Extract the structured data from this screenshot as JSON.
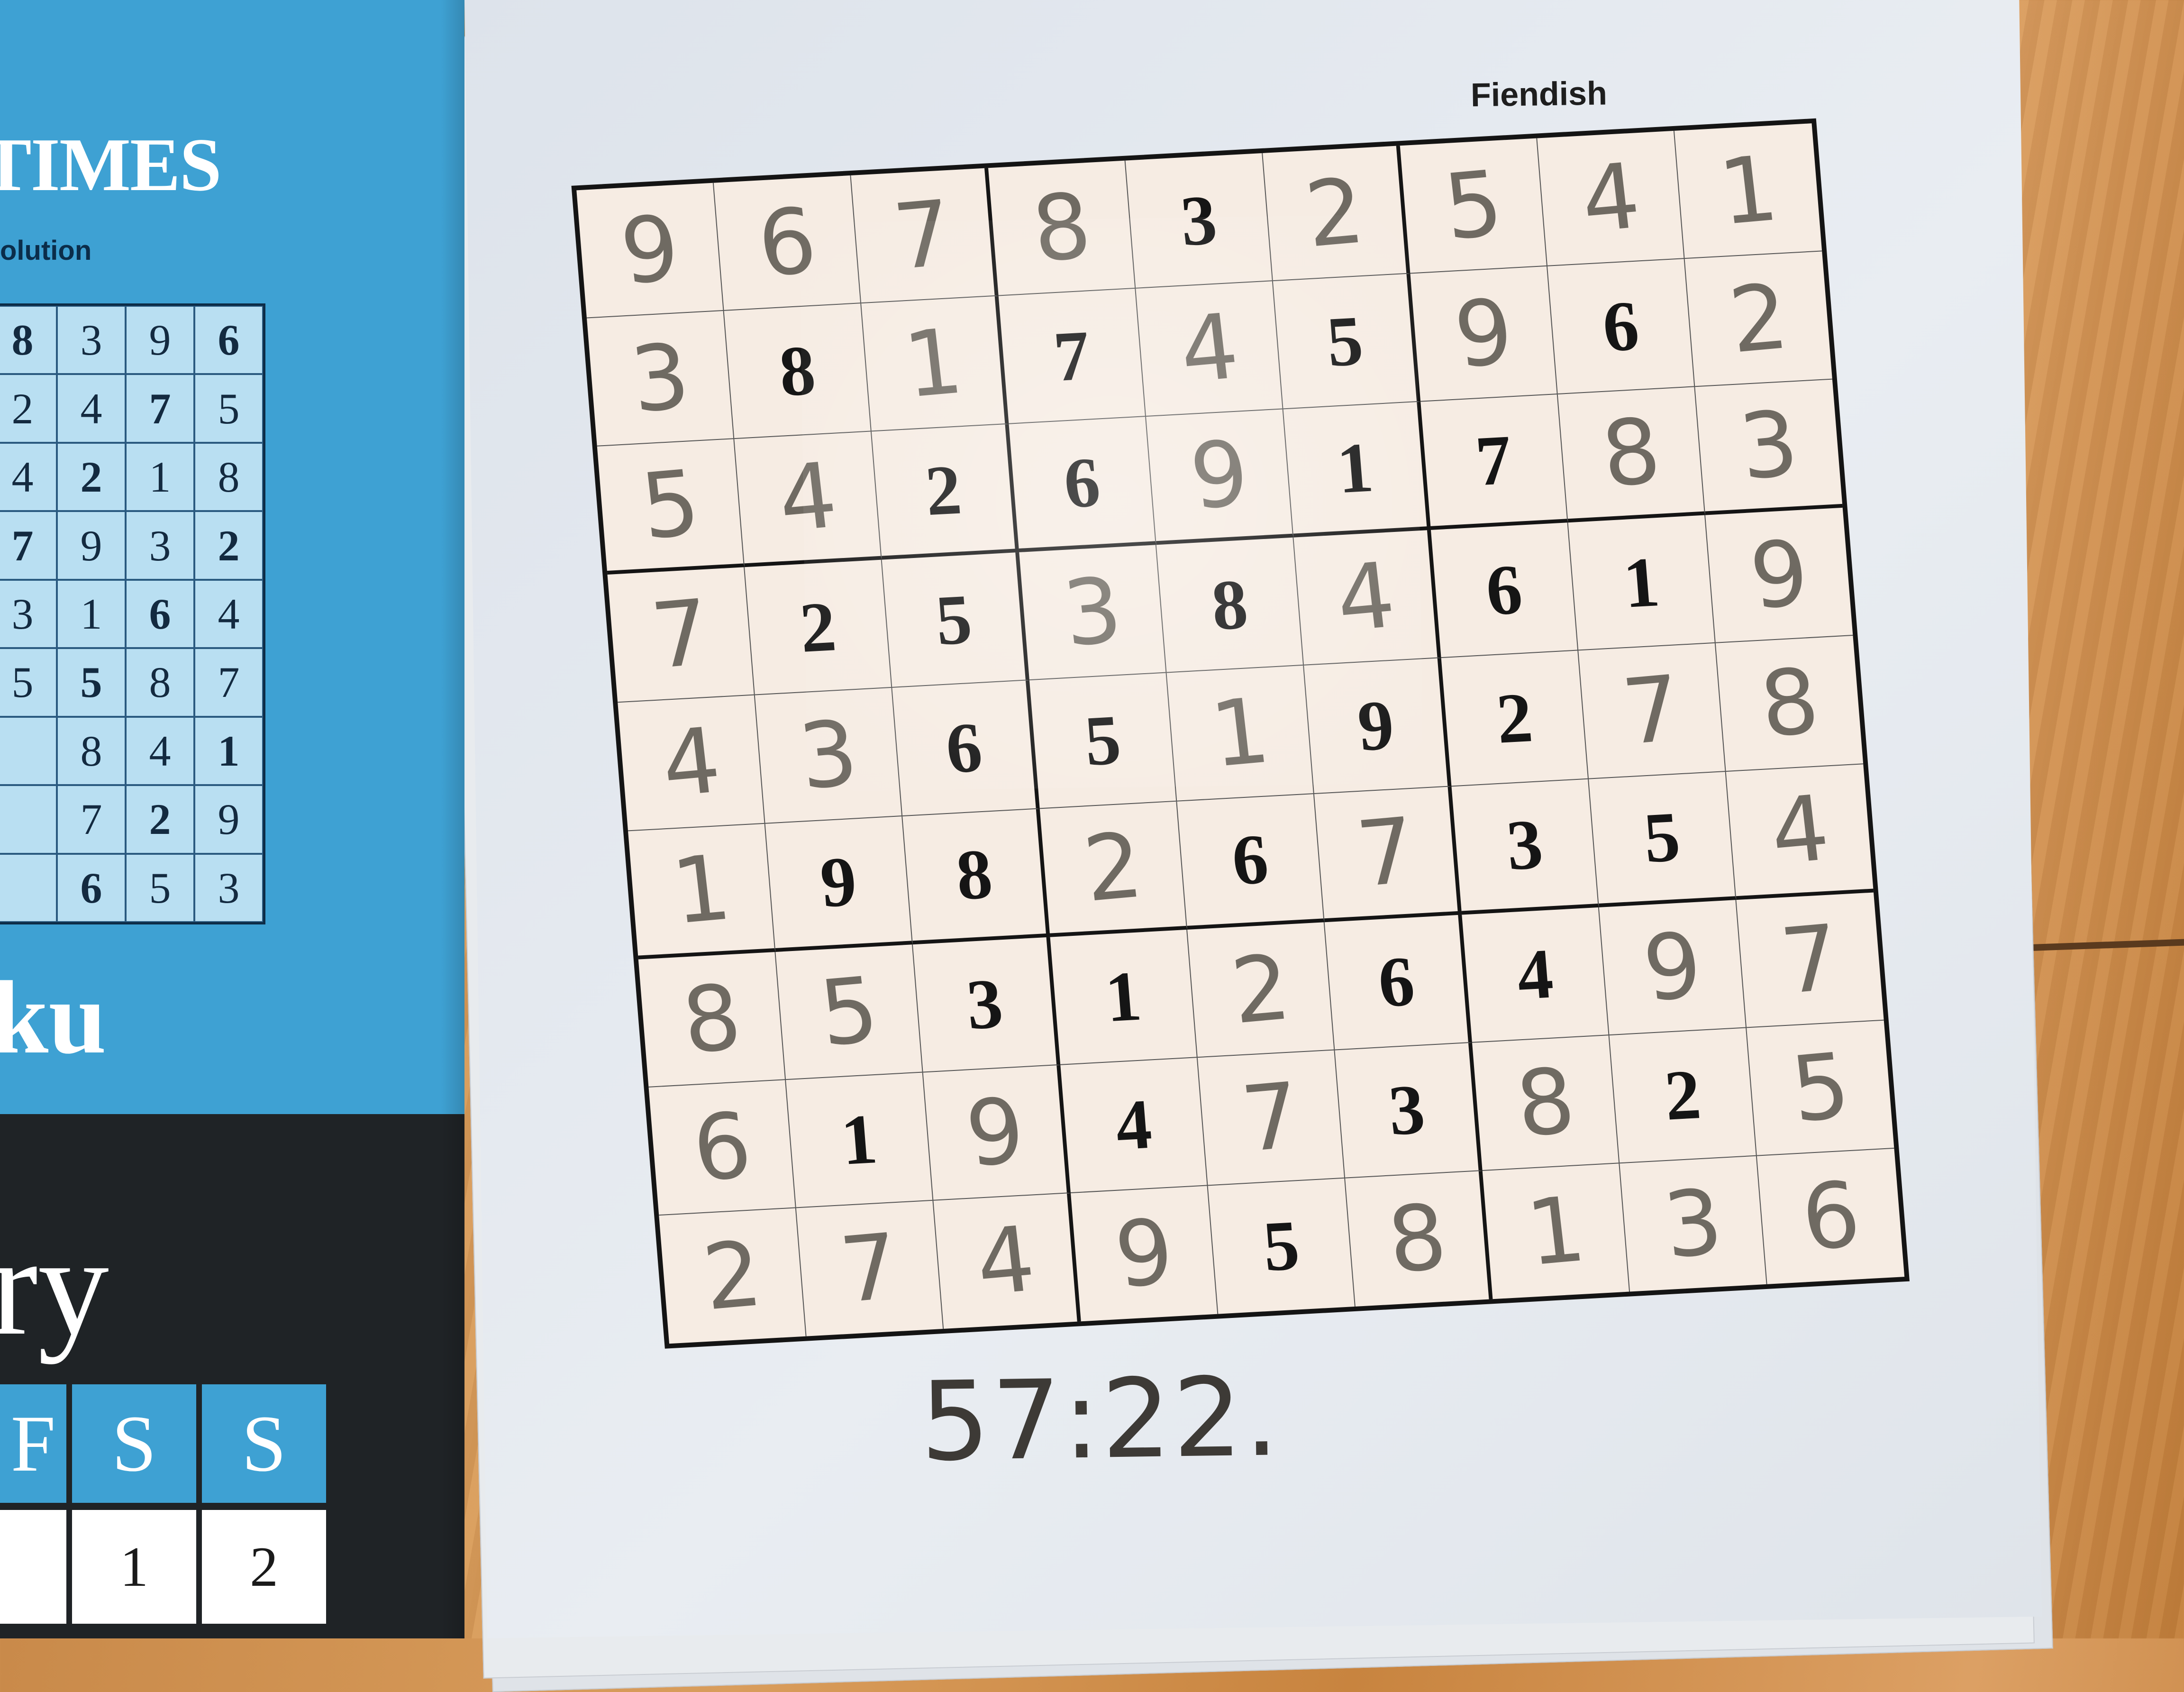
{
  "left_page": {
    "masthead": "TIMES",
    "solution_label": "olution",
    "mini_grid": [
      [
        "8",
        "3",
        "9",
        "6"
      ],
      [
        "2",
        "4",
        "7",
        "5"
      ],
      [
        "4",
        "2",
        "1",
        "8"
      ],
      [
        "7",
        "9",
        "3",
        "2"
      ],
      [
        "3",
        "1",
        "6",
        "4"
      ],
      [
        "5",
        "5",
        "8",
        "7"
      ],
      [
        "",
        "8",
        "4",
        "1"
      ],
      [
        "",
        "7",
        "2",
        "9"
      ],
      [
        "",
        "6",
        "5",
        "3"
      ]
    ],
    "ku_text": "ku",
    "ry_text": "ry",
    "calendar_headers": [
      "F",
      "S",
      "S"
    ],
    "calendar_days": [
      "",
      "1",
      "2"
    ]
  },
  "puzzle": {
    "difficulty": "Fiendish",
    "grid": [
      [
        "9",
        "6",
        "7",
        "8",
        "3",
        "2",
        "5",
        "4",
        "1"
      ],
      [
        "3",
        "8",
        "1",
        "7",
        "4",
        "5",
        "9",
        "6",
        "2"
      ],
      [
        "5",
        "4",
        "2",
        "6",
        "9",
        "1",
        "7",
        "8",
        "3"
      ],
      [
        "7",
        "2",
        "5",
        "3",
        "8",
        "4",
        "6",
        "1",
        "9"
      ],
      [
        "4",
        "3",
        "6",
        "5",
        "1",
        "9",
        "2",
        "7",
        "8"
      ],
      [
        "1",
        "9",
        "8",
        "2",
        "6",
        "7",
        "3",
        "5",
        "4"
      ],
      [
        "8",
        "5",
        "3",
        "1",
        "2",
        "6",
        "4",
        "9",
        "7"
      ],
      [
        "6",
        "1",
        "9",
        "4",
        "7",
        "3",
        "8",
        "2",
        "5"
      ],
      [
        "2",
        "7",
        "4",
        "9",
        "5",
        "8",
        "1",
        "3",
        "6"
      ]
    ],
    "printed": [
      [
        0,
        0,
        0,
        0,
        1,
        0,
        0,
        0,
        0
      ],
      [
        0,
        1,
        0,
        1,
        0,
        1,
        0,
        1,
        0
      ],
      [
        0,
        0,
        1,
        1,
        0,
        1,
        1,
        0,
        0
      ],
      [
        0,
        1,
        1,
        0,
        1,
        0,
        1,
        1,
        0
      ],
      [
        0,
        0,
        1,
        1,
        0,
        1,
        1,
        0,
        0
      ],
      [
        0,
        1,
        1,
        0,
        1,
        0,
        1,
        1,
        0
      ],
      [
        0,
        0,
        1,
        1,
        0,
        1,
        1,
        0,
        0
      ],
      [
        0,
        1,
        0,
        1,
        0,
        1,
        0,
        1,
        0
      ],
      [
        0,
        0,
        0,
        0,
        1,
        0,
        0,
        0,
        0
      ]
    ],
    "time": "57:22."
  }
}
